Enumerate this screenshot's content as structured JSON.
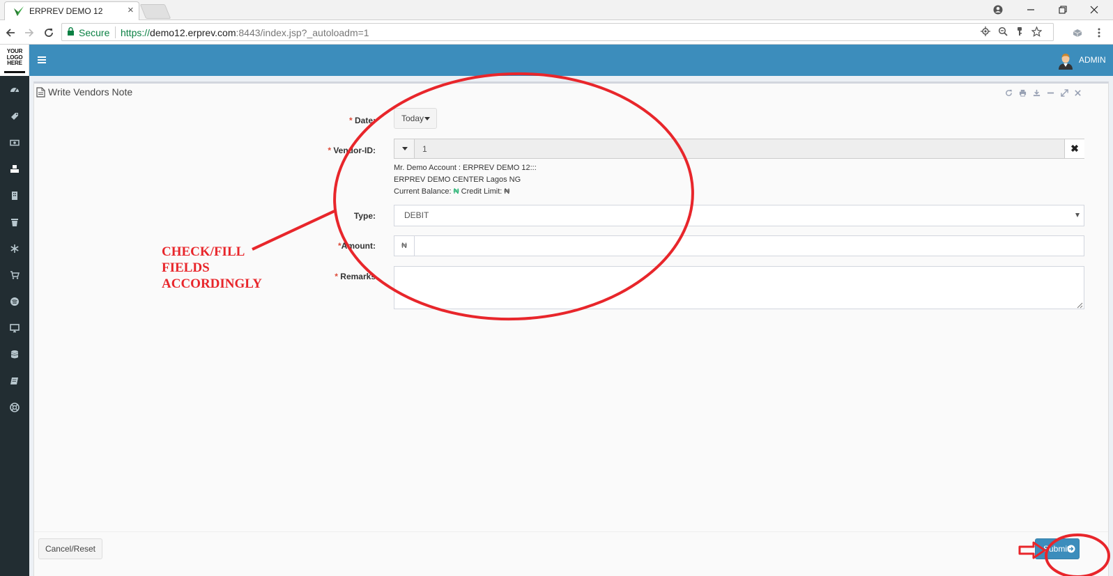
{
  "browser": {
    "tab_title": "ERPREV DEMO 12",
    "tab_close": "×",
    "secure_label": "Secure",
    "url_scheme": "https://",
    "url_host": "demo12.erprev.com",
    "url_rest": ":8443/index.jsp?_autoloadm=1"
  },
  "header": {
    "logo_lines": [
      "YOUR",
      "LOGO",
      "HERE"
    ],
    "user_label": "ADMIN"
  },
  "sidebar": {
    "icons": [
      "dashboard-icon",
      "tag-icon",
      "money-icon",
      "cubes-icon",
      "building-icon",
      "trash-icon",
      "snowflake-icon",
      "cart-icon",
      "spotify-icon",
      "desktop-icon",
      "database-icon",
      "book-icon",
      "lifesaver-icon"
    ]
  },
  "panel": {
    "title": "Write Vendors Note",
    "tools": [
      "refresh-icon",
      "print-icon",
      "download-icon",
      "minimize-icon",
      "expand-icon",
      "close-icon"
    ]
  },
  "form": {
    "required_mark": "*",
    "date": {
      "label": "Date:",
      "button_label": "Today"
    },
    "vendor": {
      "label": "Vendor-ID:",
      "value": "1",
      "clear_label": "✖",
      "info_line1": "Mr. Demo Account : ERPREV DEMO 12:::",
      "info_line2": "ERPREV DEMO CENTER Lagos NG",
      "balance_label": "Current Balance:",
      "balance_symbol": "₦",
      "credit_label": "Credit Limit:",
      "credit_symbol": "₦"
    },
    "type": {
      "label": "Type:",
      "value": "DEBIT"
    },
    "amount": {
      "label": "Amount:",
      "currency": "₦",
      "value": ""
    },
    "remarks": {
      "label": "Remarks",
      "value": ""
    }
  },
  "footer": {
    "cancel_label": "Cancel/Reset",
    "submit_label": "Submit"
  },
  "annotation": {
    "lines": [
      "CHECK/FILL",
      "FIELDS",
      "ACCORDINGLY"
    ],
    "color": "#e8262b"
  },
  "colors": {
    "header_blue": "#3c8dbc",
    "sidebar_dark": "#222d32",
    "required_red": "#dd4b39",
    "naira_green": "#00a65a"
  }
}
